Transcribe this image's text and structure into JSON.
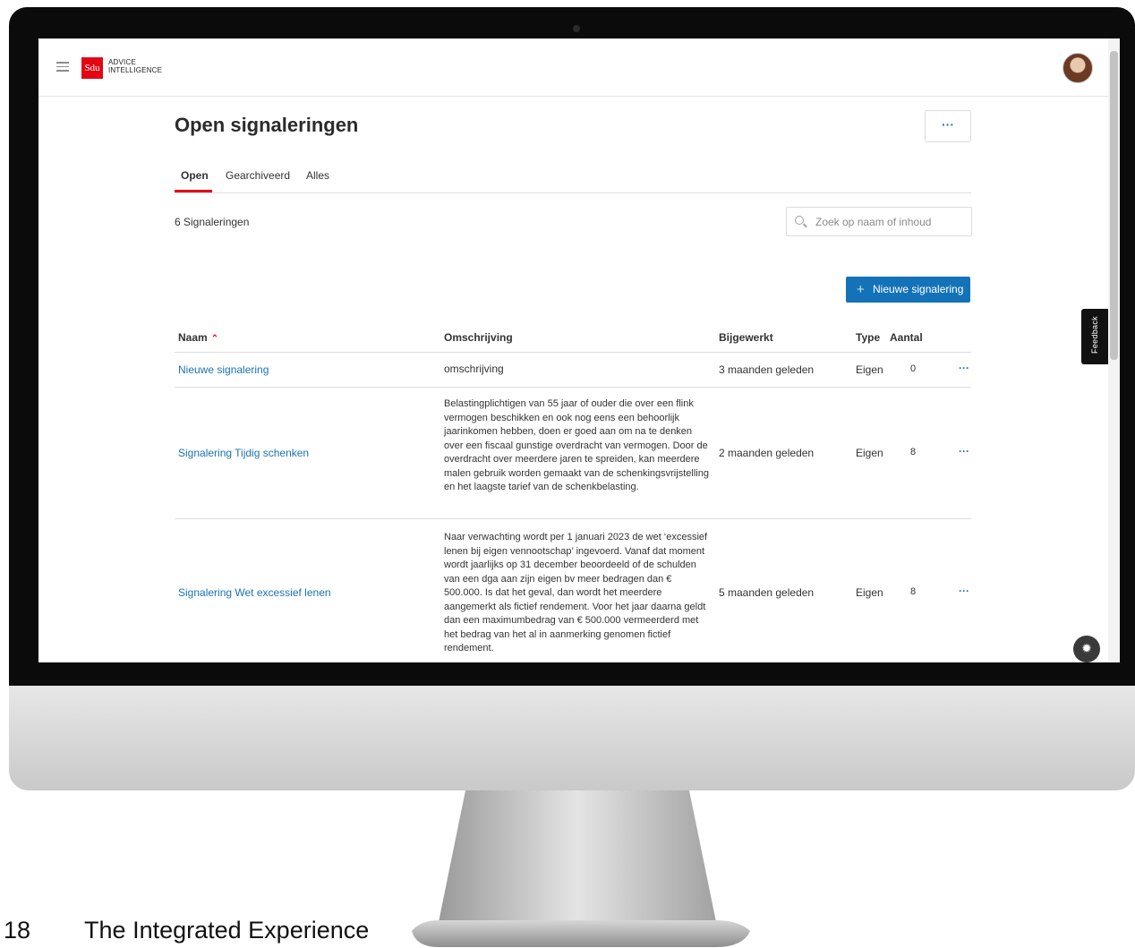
{
  "header": {
    "logo_mark": "Sdu",
    "logo_line1": "ADVICE",
    "logo_line2": "INTELLIGENCE"
  },
  "page": {
    "title": "Open signaleringen",
    "more_label": "···"
  },
  "tabs": [
    {
      "label": "Open",
      "active": true
    },
    {
      "label": "Gearchiveerd",
      "active": false
    },
    {
      "label": "Alles",
      "active": false
    }
  ],
  "summary": {
    "count_text": "6 Signaleringen"
  },
  "search": {
    "placeholder": "Zoek op naam of inhoud"
  },
  "actions": {
    "new_label": "Nieuwe signalering",
    "plus": "+"
  },
  "table": {
    "headers": {
      "name": "Naam",
      "description": "Omschrijving",
      "updated": "Bijgewerkt",
      "type": "Type",
      "count": "Aantal"
    },
    "rows": [
      {
        "name": "Nieuwe signalering",
        "description": "omschrijving",
        "updated": "3 maanden geleden",
        "type": "Eigen",
        "count": "0"
      },
      {
        "name": "Signalering Tijdig schenken",
        "description": "Belastingplichtigen van 55 jaar of ouder die over een flink vermogen beschikken en ook nog eens een behoorlijk jaarinkomen hebben, doen er goed aan om na te denken over een fiscaal gunstige overdracht van vermogen. Door de overdracht over meerdere jaren te spreiden, kan meerdere malen gebruik worden gemaakt van de schenkingsvrijstelling en het laagste tarief van de schenkbelasting.",
        "updated": "2 maanden geleden",
        "type": "Eigen",
        "count": "8"
      },
      {
        "name": "Signalering Wet excessief lenen",
        "description": "Naar verwachting wordt per 1 januari 2023 de wet ‘excessief lenen bij eigen vennootschap’ ingevoerd. Vanaf dat moment wordt jaarlijks op 31 december beoordeeld of de schulden van een dga aan zijn eigen bv meer bedragen dan € 500.000. Is dat het geval, dan wordt het meerdere aangemerkt als fictief rendement. Voor het jaar daarna geldt dan een maximumbedrag van € 500.000 vermeerderd met het bedrag van het al in aanmerking genomen fictief rendement.",
        "updated": "5 maanden geleden",
        "type": "Eigen",
        "count": "8"
      }
    ],
    "row_menu": "···"
  },
  "feedback": {
    "label": "Feedback"
  },
  "footer": {
    "page_number": "18",
    "title": "The Integrated Experience"
  }
}
